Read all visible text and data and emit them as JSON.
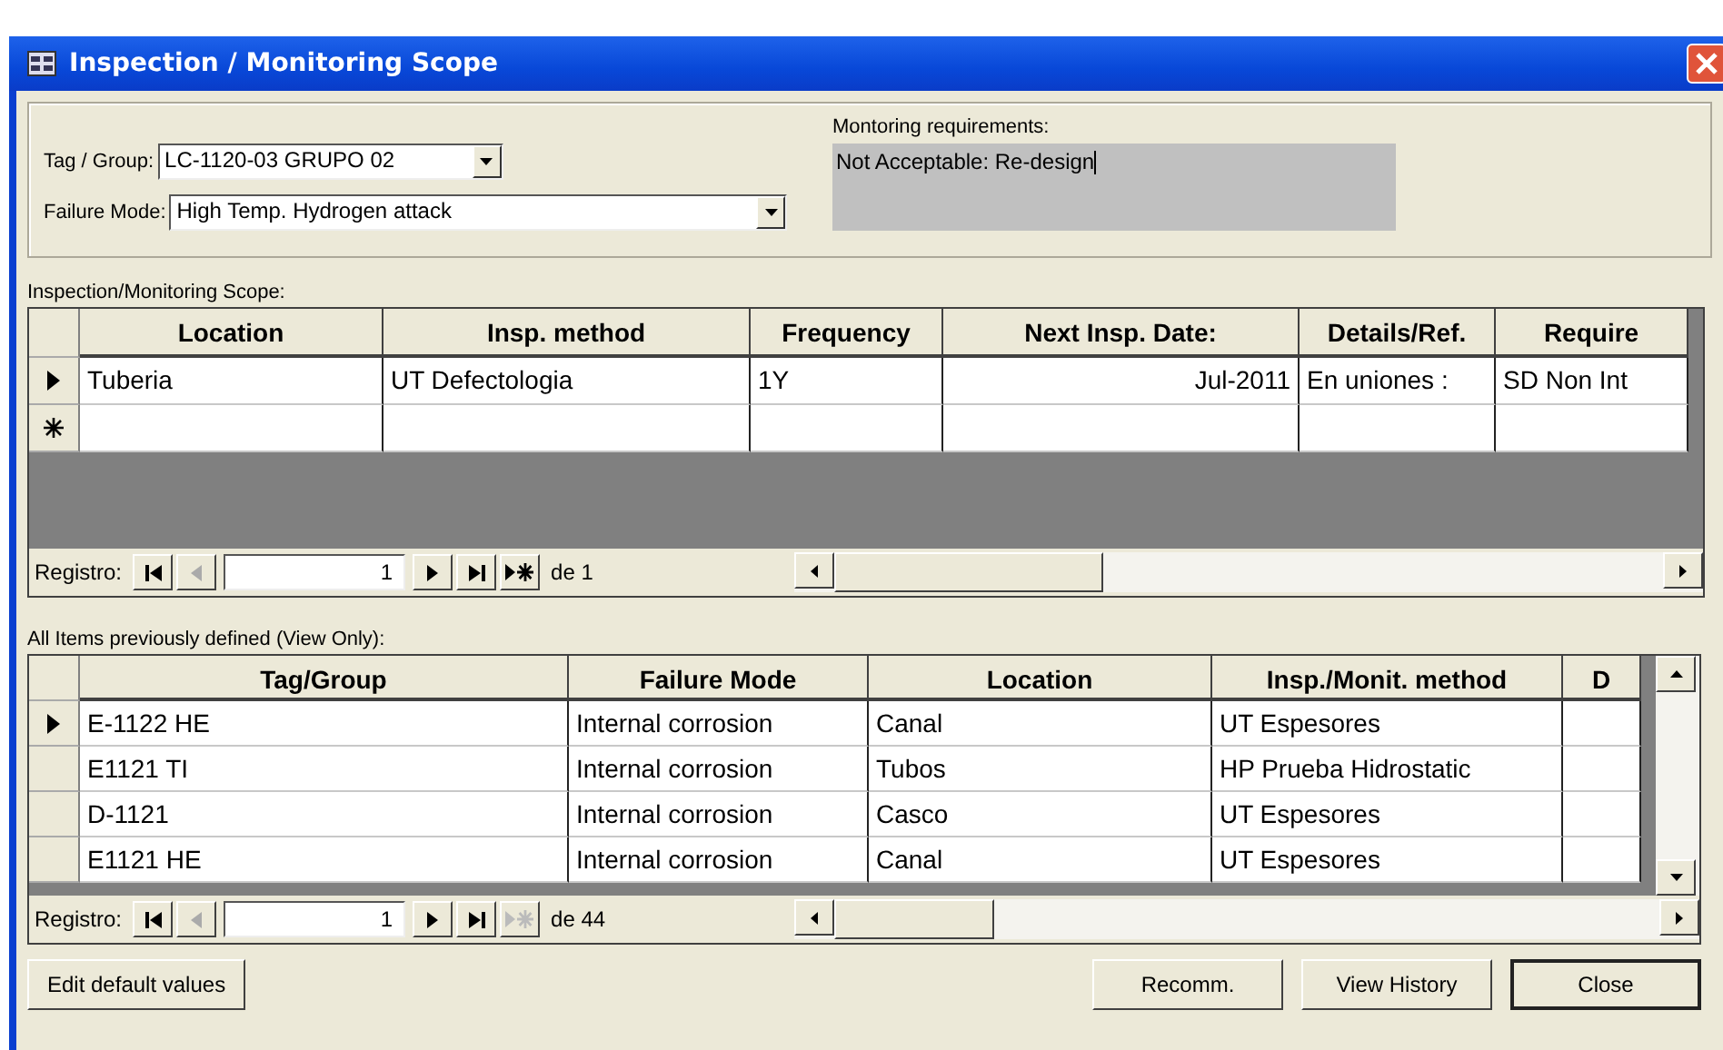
{
  "window": {
    "title": "Inspection / Monitoring Scope"
  },
  "tag_group": {
    "label": "Tag / Group:",
    "value": "LC-1120-03 GRUPO 02"
  },
  "failure_mode": {
    "label": "Failure Mode:",
    "value": "High Temp. Hydrogen attack"
  },
  "monitoring_requirements": {
    "label": "Montoring requirements:",
    "value": "Not Acceptable: Re-design"
  },
  "scope": {
    "label": "Inspection/Monitoring Scope:",
    "new_row": true,
    "columns": [
      "Location",
      "Insp. method",
      "Frequency",
      "Next Insp. Date:",
      "Details/Ref.",
      "Require"
    ],
    "rows": [
      {
        "current": true,
        "cells": [
          "Tuberia",
          "UT Defectologia",
          "1Y",
          "Jul-2011",
          "En uniones :",
          "SD Non Int"
        ]
      }
    ],
    "navigator": {
      "label": "Registro:",
      "record": "1",
      "total": "de 1",
      "previous_enabled": false,
      "new_record_enabled": true
    }
  },
  "previous": {
    "label": "All Items previously defined (View Only):",
    "columns": [
      "Tag/Group",
      "Failure Mode",
      "Location",
      "Insp./Monit. method",
      "D"
    ],
    "rows": [
      {
        "current": true,
        "cells": [
          "E-1122 HE",
          "Internal corrosion",
          "Canal",
          "UT Espesores",
          ""
        ]
      },
      {
        "current": false,
        "cells": [
          "E1121 TI",
          "Internal corrosion",
          "Tubos",
          "HP Prueba Hidrostatic",
          ""
        ]
      },
      {
        "current": false,
        "cells": [
          "D-1121",
          "Internal corrosion",
          "Casco",
          "UT Espesores",
          ""
        ]
      },
      {
        "current": false,
        "cells": [
          "E1121 HE",
          "Internal corrosion",
          "Canal",
          "UT Espesores",
          ""
        ]
      }
    ],
    "navigator": {
      "label": "Registro:",
      "record": "1",
      "total": "de 44",
      "previous_enabled": false,
      "new_record_enabled": false
    }
  },
  "buttons": [
    {
      "label": "Edit default values",
      "kind": "left"
    },
    {
      "label": "Recomm.",
      "kind": "right"
    },
    {
      "label": "View History",
      "kind": "right"
    },
    {
      "label": "Close",
      "kind": "default"
    }
  ]
}
